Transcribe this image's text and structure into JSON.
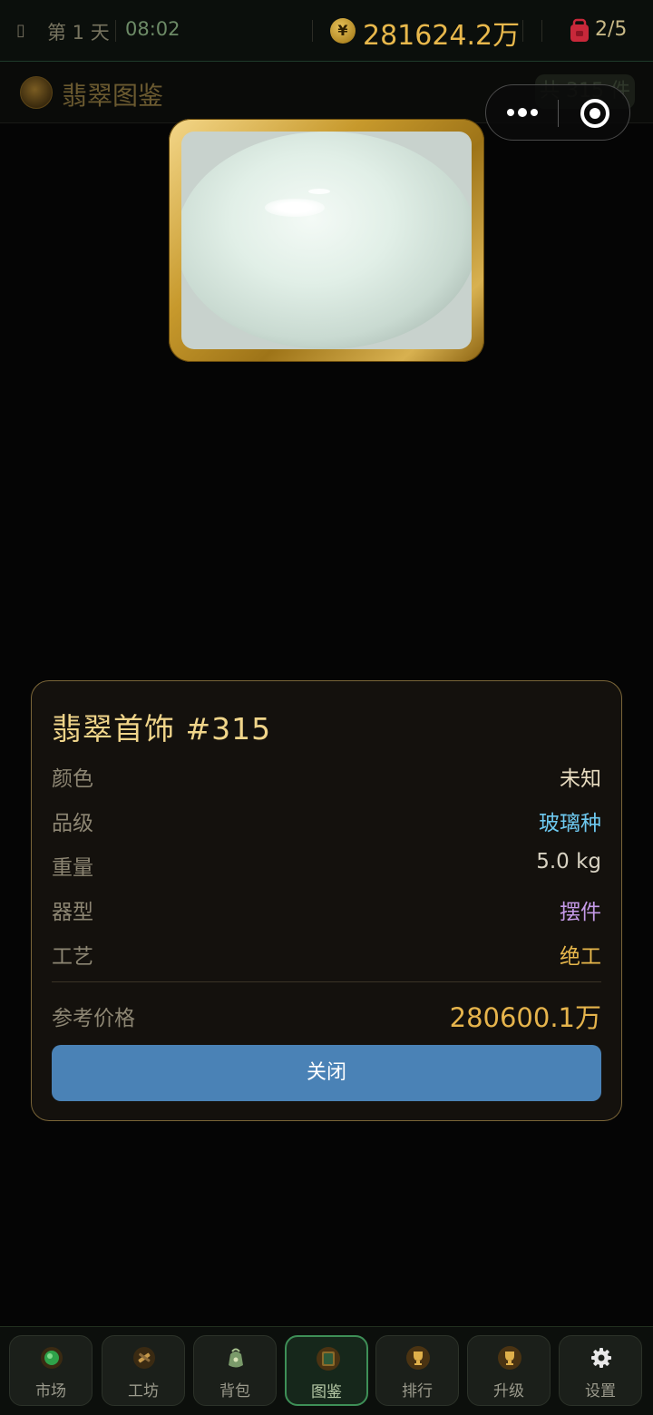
{
  "status_bar": {
    "day_label": "第 1 天",
    "time": "08:02",
    "coin_symbol": "¥",
    "money": "281624.2万",
    "bag_count": "2/5"
  },
  "subheader": {
    "title": "翡翠图鉴",
    "count_badge": "共 315 件"
  },
  "capsule": {
    "more_icon": "more-dots-icon",
    "close_icon": "target-circle-icon"
  },
  "item_image": {
    "icon": "jade-ornament-image"
  },
  "detail": {
    "title": "翡翠首饰 #315",
    "rows": [
      {
        "label": "颜色",
        "value": "未知",
        "color": "#e8dcc0"
      },
      {
        "label": "品级",
        "value": "玻璃种",
        "color": "#6ec9f0"
      },
      {
        "label": "重量",
        "value": "5.0 kg",
        "color": "#d8d2c2"
      },
      {
        "label": "器型",
        "value": "摆件",
        "color": "#c59ae8"
      },
      {
        "label": "工艺",
        "value": "绝工",
        "color": "#e8b84c"
      }
    ],
    "price_label": "参考价格",
    "price_value": "280600.1万",
    "close_button": "关闭"
  },
  "bottom_nav": {
    "tabs": [
      {
        "label": "市场",
        "icon": "globe-icon"
      },
      {
        "label": "工坊",
        "icon": "tools-icon"
      },
      {
        "label": "背包",
        "icon": "bag-icon"
      },
      {
        "label": "图鉴",
        "icon": "book-icon",
        "active": true
      },
      {
        "label": "排行",
        "icon": "trophy-icon"
      },
      {
        "label": "升级",
        "icon": "trophy-upgrade-icon"
      },
      {
        "label": "设置",
        "icon": "gear-icon"
      }
    ]
  },
  "colors": {
    "gold": "#e8b84c",
    "accent_blue": "#4a82b6",
    "active_tab_border": "#3e8f57",
    "dialog_border": "#7a6538"
  }
}
